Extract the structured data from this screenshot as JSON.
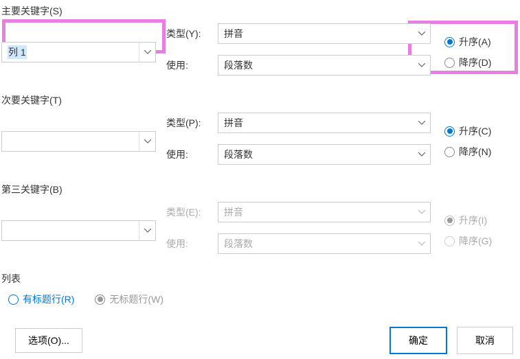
{
  "primary": {
    "header": "主要关键字(S)",
    "key_value": "列 1",
    "type_label": "类型(Y):",
    "type_value": "拼音",
    "using_label": "使用:",
    "using_value": "段落数",
    "asc_label": "升序(A)",
    "desc_label": "降序(D)"
  },
  "secondary": {
    "header": "次要关键字(T)",
    "key_value": "",
    "type_label": "类型(P):",
    "type_value": "拼音",
    "using_label": "使用:",
    "using_value": "段落数",
    "asc_label": "升序(C)",
    "desc_label": "降序(N)"
  },
  "tertiary": {
    "header": "第三关键字(B)",
    "key_value": "",
    "type_label": "类型(E):",
    "type_value": "拼音",
    "using_label": "使用:",
    "using_value": "段落数",
    "asc_label": "升序(I)",
    "desc_label": "降序(G)"
  },
  "list": {
    "header": "列表",
    "has_header": "有标题行(R)",
    "no_header": "无标题行(W)"
  },
  "buttons": {
    "options": "选项(O)...",
    "ok": "确定",
    "cancel": "取消"
  }
}
